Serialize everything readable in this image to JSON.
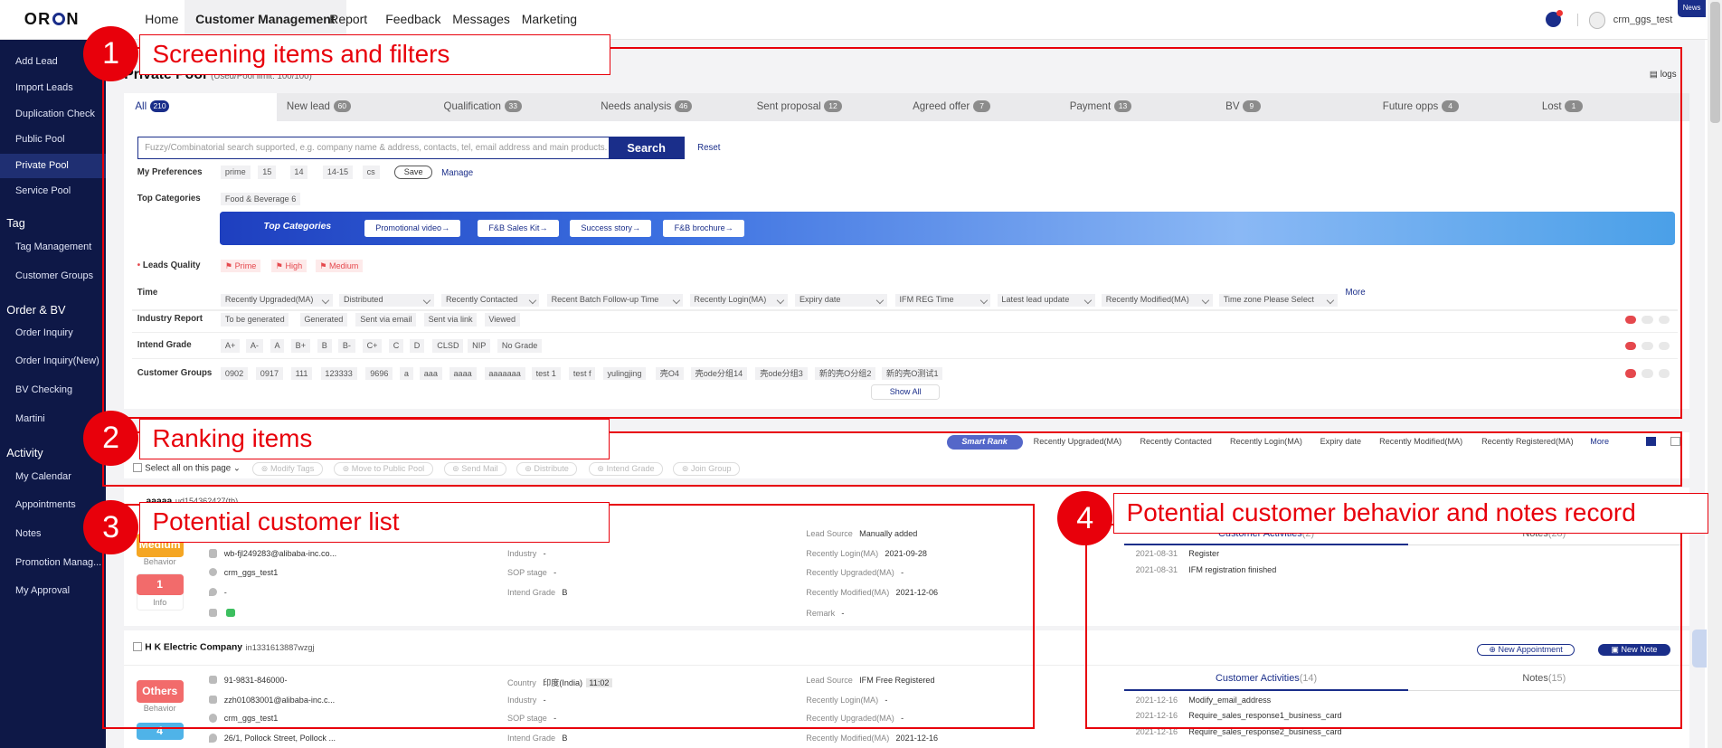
{
  "brand": {
    "logo": "ORION"
  },
  "nav": {
    "items": [
      "Home",
      "Customer Management",
      "Report",
      "Feedback",
      "Messages",
      "Marketing"
    ],
    "active": "Customer Management"
  },
  "user": {
    "name": "crm_ggs_test",
    "news_label": "News"
  },
  "sidebar": {
    "items": [
      "Add Lead",
      "Import Leads",
      "Duplication Check",
      "Public Pool",
      "Private Pool",
      "Service Pool"
    ],
    "tag_head": "Tag",
    "tag_items": [
      "Tag Management",
      "Customer Groups"
    ],
    "order_head": "Order & BV",
    "order_items": [
      "Order Inquiry",
      "Order Inquiry(New)",
      "BV Checking",
      "Martini"
    ],
    "activity_head": "Activity",
    "activity_items": [
      "My Calendar",
      "Appointments",
      "Notes",
      "Promotion Manag...",
      "My Approval"
    ]
  },
  "page": {
    "title": "Private Pool",
    "subtitle": "(Used/Pool limit: 100/100)",
    "logs": "logs"
  },
  "tabs": [
    {
      "label": "All",
      "count": "210"
    },
    {
      "label": "New lead",
      "count": "60"
    },
    {
      "label": "Qualification",
      "count": "33"
    },
    {
      "label": "Needs analysis",
      "count": "46"
    },
    {
      "label": "Sent proposal",
      "count": "12"
    },
    {
      "label": "Agreed offer",
      "count": "7"
    },
    {
      "label": "Payment",
      "count": "13"
    },
    {
      "label": "BV",
      "count": "9"
    },
    {
      "label": "Future opps",
      "count": "4"
    },
    {
      "label": "Lost",
      "count": "1"
    }
  ],
  "search": {
    "placeholder": "Fuzzy/Combinatorial search supported, e.g. company name & address, contacts, tel, email address and main products.",
    "button": "Search",
    "reset": "Reset"
  },
  "filters": {
    "preferences_label": "My Preferences",
    "preferences": [
      "prime",
      "15",
      "14",
      "14-15",
      "cs"
    ],
    "save": "Save",
    "manage": "Manage",
    "top_categories_label": "Top Categories",
    "top_category_chip": "Food & Beverage",
    "top_category_count": "6",
    "banner_title": "Top Categories",
    "banner_buttons": [
      "Promotional video→",
      "F&B Sales Kit→",
      "Success story→",
      "F&B brochure→"
    ],
    "quality_label": "Leads Quality",
    "quality": [
      "Prime",
      "High",
      "Medium"
    ],
    "time_label": "Time",
    "time_dropdowns": [
      "Recently Upgraded(MA)",
      "Distributed",
      "Recently Contacted",
      "Recent Batch Follow-up Time",
      "Recently Login(MA)",
      "Expiry date",
      "IFM REG Time",
      "Latest lead update",
      "Recently Modified(MA)",
      "Time zone  Please Select"
    ],
    "time_more": "More",
    "industry_label": "Industry Report",
    "industry": [
      "To be generated",
      "Generated",
      "Sent via email",
      "Sent via link",
      "Viewed"
    ],
    "intend_label": "Intend Grade",
    "intend": [
      "A+",
      "A-",
      "A",
      "B+",
      "B",
      "B-",
      "C+",
      "C",
      "D",
      "CLSD",
      "NIP",
      "No Grade"
    ],
    "groups_label": "Customer Groups",
    "groups": [
      "0902",
      "0917",
      "111",
      "123333",
      "9696",
      "a",
      "aaa",
      "aaaa",
      "aaaaaaa",
      "test 1",
      "test f",
      "yulingjing",
      "壳O4",
      "壳ode分组14",
      "壳ode分组3",
      "新的壳O分组2",
      "新的壳O测试1"
    ],
    "show_all": "Show All"
  },
  "ranking": {
    "smart": "Smart Rank",
    "items": [
      "Recently Upgraded(MA)",
      "Recently Contacted",
      "Recently Login(MA)",
      "Expiry date",
      "Recently Modified(MA)",
      "Recently Registered(MA)",
      "More"
    ],
    "select_all": "Select all on this page",
    "actions": [
      "Modify Tags",
      "Move to Public Pool",
      "Send Mail",
      "Distribute",
      "Intend Grade",
      "Join Group"
    ]
  },
  "customers": [
    {
      "name": "aaaaa",
      "id": "ud154362427(tb)",
      "quality": "Medium",
      "quality_sub": "Behavior",
      "info_count": "1",
      "info_label": "Info",
      "email": "wb-fjl249283@alibaba-inc.co...",
      "owner": "crm_ggs_test1",
      "location": "-",
      "industry": "-",
      "sop": "-",
      "intend": "B",
      "lead_source": "Manually added",
      "login": "2021-09-28",
      "upgraded": "-",
      "modified": "2021-12-06",
      "remark": "-",
      "activities_tab": "Customer Activities",
      "activities_count": "(2)",
      "notes_tab": "Notes",
      "notes_count": "(28)",
      "activities": [
        {
          "date": "2021-08-31",
          "text": "Register"
        },
        {
          "date": "2021-08-31",
          "text": "IFM registration finished"
        }
      ]
    },
    {
      "name": "H K Electric Company",
      "id": "in1331613887wzgj",
      "quality": "Others",
      "quality_sub": "Behavior",
      "info_count": "4",
      "phone": "91-9831-846000-",
      "email": "zzh01083001@alibaba-inc.c...",
      "owner": "crm_ggs_test1",
      "location": "26/1, Pollock Street, Pollock ...",
      "country": "印度(India)",
      "time": "11:02",
      "industry": "-",
      "sop": "-",
      "intend": "B",
      "lead_source": "IFM Free Registered",
      "login": "-",
      "upgraded": "-",
      "modified": "2021-12-16",
      "new_appointment": "New Appointment",
      "new_note": "New Note",
      "activities_tab": "Customer Activities",
      "activities_count": "(14)",
      "notes_tab": "Notes",
      "notes_count": "(15)",
      "activities": [
        {
          "date": "2021-12-16",
          "text": "Modify_email_address"
        },
        {
          "date": "2021-12-16",
          "text": "Require_sales_response1_business_card"
        },
        {
          "date": "2021-12-16",
          "text": "Require_sales_response2_business_card"
        }
      ]
    }
  ],
  "field_labels": {
    "lead_source": "Lead Source",
    "login": "Recently Login(MA)",
    "upgraded": "Recently Upgraded(MA)",
    "modified": "Recently Modified(MA)",
    "remark": "Remark",
    "industry": "Industry",
    "sop": "SOP stage",
    "intend": "Intend Grade",
    "country": "Country"
  },
  "annotations": [
    {
      "num": "1",
      "label": "Screening items and filters"
    },
    {
      "num": "2",
      "label": "Ranking items"
    },
    {
      "num": "3",
      "label": "Potential customer list"
    },
    {
      "num": "4",
      "label": "Potential customer behavior and notes record"
    }
  ],
  "colors": {
    "brand": "#1a2e8a",
    "sidebar": "#0e1847",
    "annotation": "#e8000b",
    "quality_medium": "#f5a623",
    "quality_others": "#f26b6b"
  }
}
